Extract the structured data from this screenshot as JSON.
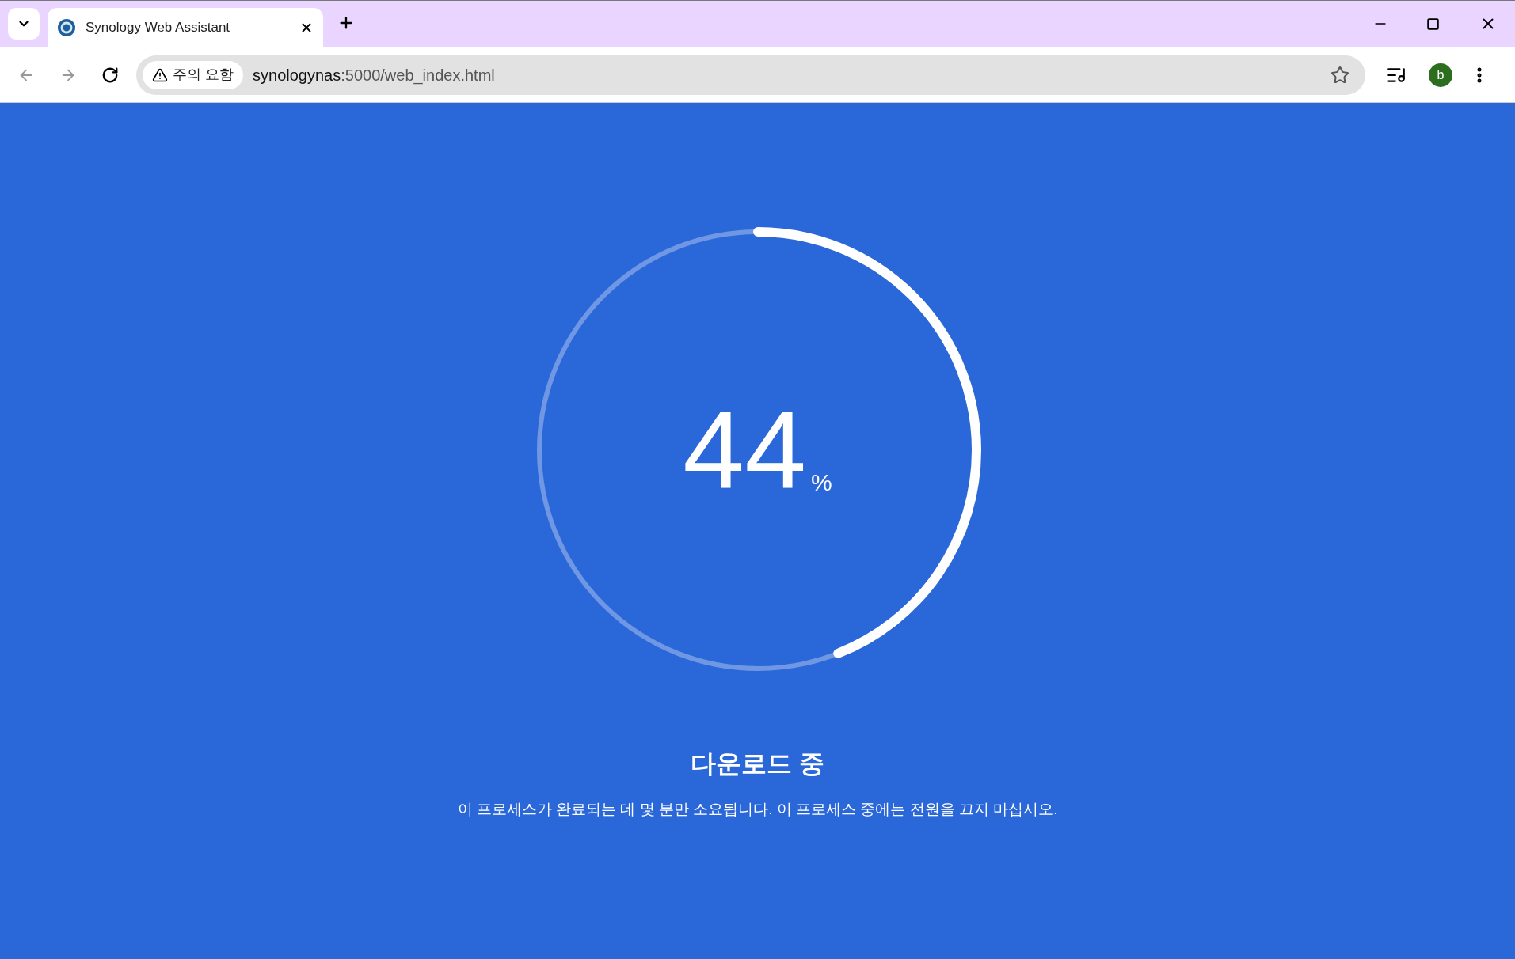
{
  "browser": {
    "tab": {
      "title": "Synology Web Assistant",
      "selected": true
    },
    "security_chip": "주의 요함",
    "url_host": "synologynas",
    "url_path": ":5000/web_index.html",
    "profile_initial": "b"
  },
  "progress": {
    "level": 0.44,
    "value": "44",
    "unit": "%"
  },
  "title": "다운로드 중",
  "message": "이 프로세스가 완료되는 데 몇 분만 소요됩니다. 이 프로세스 중에는 전원을 끄지 마십시오."
}
